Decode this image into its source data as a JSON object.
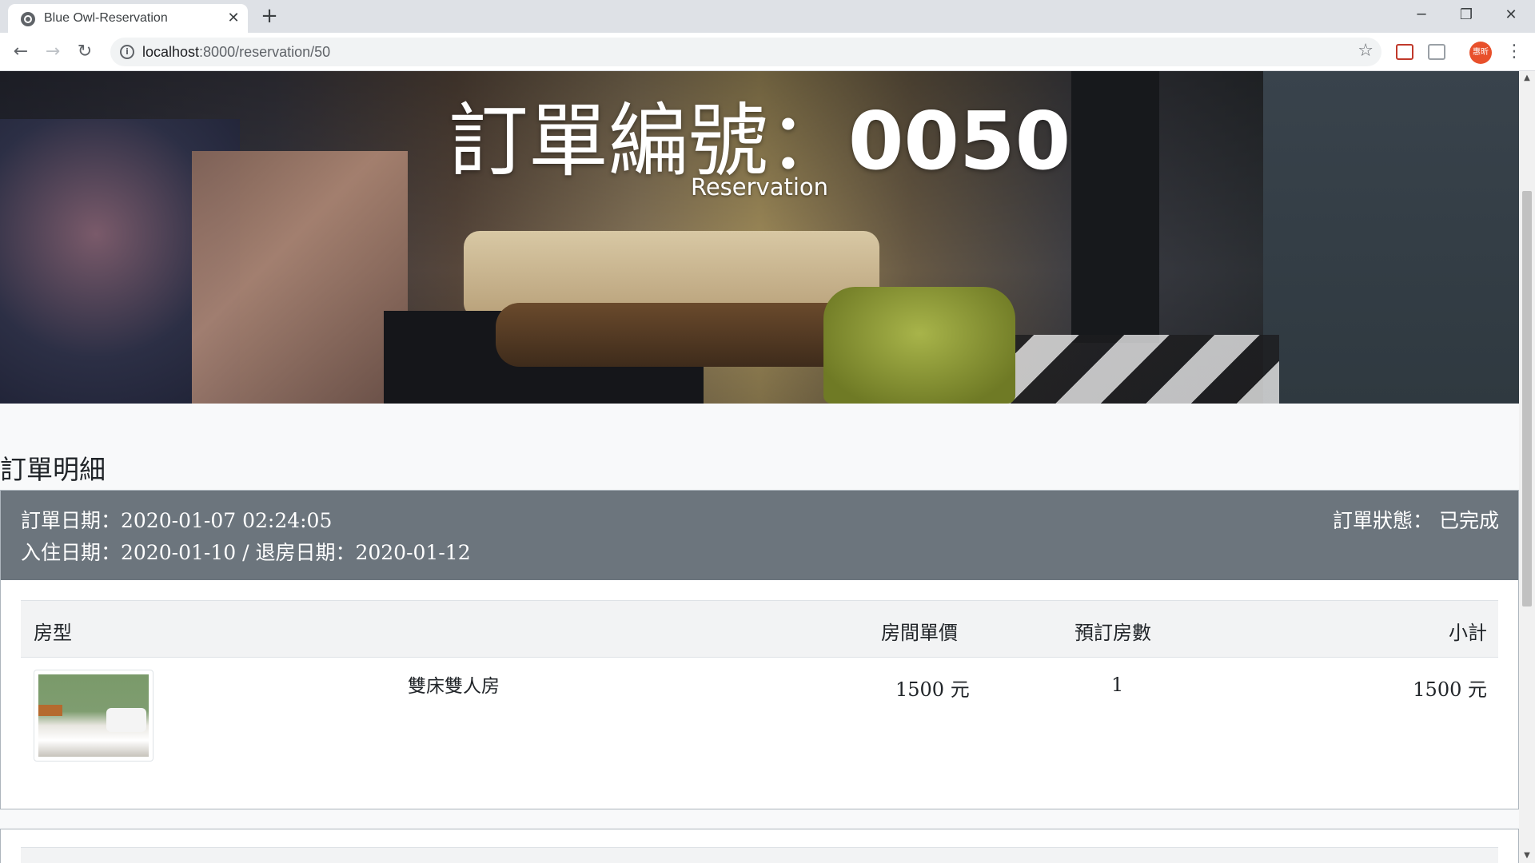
{
  "browser": {
    "tab_title": "Blue Owl-Reservation",
    "url_host": "localhost",
    "url_path": ":8000/reservation/50",
    "profile_label": "惠昕"
  },
  "hero": {
    "title_label": "訂單編號：",
    "title_number": "0050",
    "subtitle": "Reservation"
  },
  "section": {
    "title": "訂單明細"
  },
  "order": {
    "order_date": "訂單日期：2020-01-07 02:24:05",
    "stay_dates": "入住日期：2020-01-10 / 退房日期：2020-01-12",
    "status": "訂單狀態： 已完成"
  },
  "table": {
    "headers": {
      "room_type": "房型",
      "unit_price": "房間單價",
      "rooms": "預訂房數",
      "subtotal": "小計"
    },
    "rows": [
      {
        "thumb_icon": "room-photo",
        "room_name": "雙床雙人房",
        "unit_price": "1500 元",
        "rooms": "1",
        "subtotal": "1500 元"
      }
    ]
  },
  "colors": {
    "card_header_bg": "#6c757d",
    "profile_bg": "#e8502b"
  }
}
